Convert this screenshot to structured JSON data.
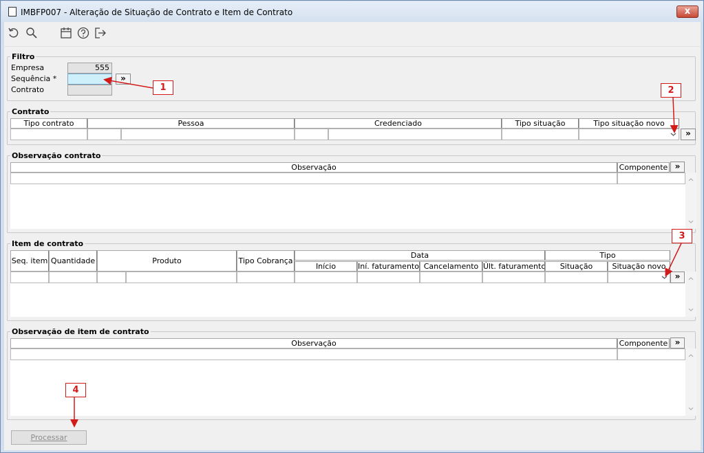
{
  "window": {
    "title": "IMBFP007 - Alteração de Situação de Contrato e Item de Contrato",
    "close_label": "x"
  },
  "toolbar": {
    "icons": [
      "undo-icon",
      "search-icon",
      "calendar-icon",
      "help-icon",
      "exit-icon"
    ]
  },
  "filtro": {
    "legend": "Filtro",
    "empresa_label": "Empresa",
    "empresa_value": "555",
    "sequencia_label": "Sequência *",
    "sequencia_value": "",
    "contrato_label": "Contrato",
    "contrato_value": "",
    "lookup_label": "»"
  },
  "contrato": {
    "legend": "Contrato",
    "columns": [
      "Tipo contrato",
      "Pessoa",
      "Credenciado",
      "Tipo situação",
      "Tipo situação novo"
    ],
    "expand_label": "»"
  },
  "obs_contrato": {
    "legend": "Observação contrato",
    "columns": [
      "Observação",
      "Componente"
    ],
    "expand_label": "»"
  },
  "item_contrato": {
    "legend": "Item de contrato",
    "columns": [
      "Seq. item",
      "Quantidade",
      "Produto",
      "Tipo Cobrança"
    ],
    "group_data": "Data",
    "data_columns": [
      "Início",
      "Iní. faturamento",
      "Cancelamento",
      "Últ. faturamento"
    ],
    "group_tipo": "Tipo",
    "tipo_columns": [
      "Situação",
      "Situação novo"
    ],
    "expand_label": "»"
  },
  "obs_item": {
    "legend": "Observação de item de contrato",
    "columns": [
      "Observação",
      "Componente"
    ],
    "expand_label": "»"
  },
  "actions": {
    "process_label": "Processar"
  },
  "annotations": [
    "1",
    "2",
    "3",
    "4"
  ],
  "colors": {
    "annotation": "#d21a1a",
    "highlight_input": "#cdf0fa"
  }
}
